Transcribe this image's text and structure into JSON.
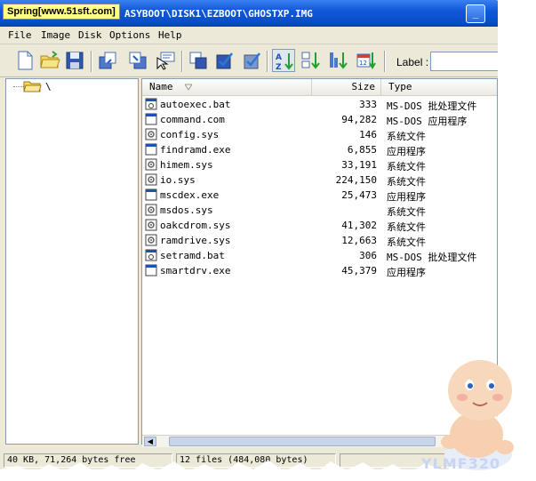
{
  "window": {
    "watermark": "Spring[www.51sft.com]",
    "title_path": "ASYBOOT\\DISK1\\EZBOOT\\GHOSTXP.IMG",
    "title_color": "#0a4cc8"
  },
  "menu": [
    {
      "label": "File"
    },
    {
      "label": "Image"
    },
    {
      "label": "Disk"
    },
    {
      "label": "Options"
    },
    {
      "label": "Help"
    }
  ],
  "toolbar": {
    "label_caption": "Label :",
    "label_value": "",
    "buttons": [
      {
        "icon": "new-file-icon"
      },
      {
        "icon": "open-folder-icon"
      },
      {
        "icon": "save-disk-icon"
      },
      {
        "icon": "extract-icon"
      },
      {
        "icon": "inject-icon"
      },
      {
        "icon": "select-icon"
      },
      {
        "icon": "copy-disk-icon"
      },
      {
        "icon": "check-icon"
      },
      {
        "icon": "verify-icon"
      },
      {
        "icon": "sort-name-icon"
      },
      {
        "icon": "sort-type-icon"
      },
      {
        "icon": "sort-size-icon"
      },
      {
        "icon": "sort-date-icon"
      }
    ]
  },
  "tree": {
    "root_label": "\\"
  },
  "list": {
    "columns": {
      "name": "Name",
      "size": "Size",
      "type": "Type"
    },
    "files": [
      {
        "name": "autoexec.bat",
        "size": "333",
        "type": "MS-DOS 批处理文件",
        "icon": "batch-file-icon"
      },
      {
        "name": "command.com",
        "size": "94,282",
        "type": "MS-DOS 应用程序",
        "icon": "application-icon"
      },
      {
        "name": "config.sys",
        "size": "146",
        "type": "系统文件",
        "icon": "system-file-icon"
      },
      {
        "name": "findramd.exe",
        "size": "6,855",
        "type": "应用程序",
        "icon": "application-icon"
      },
      {
        "name": "himem.sys",
        "size": "33,191",
        "type": "系统文件",
        "icon": "system-file-icon"
      },
      {
        "name": "io.sys",
        "size": "224,150",
        "type": "系统文件",
        "icon": "system-file-icon"
      },
      {
        "name": "mscdex.exe",
        "size": "25,473",
        "type": "应用程序",
        "icon": "application-icon"
      },
      {
        "name": "msdos.sys",
        "size": "",
        "type": "系统文件",
        "icon": "system-file-icon"
      },
      {
        "name": "oakcdrom.sys",
        "size": "41,302",
        "type": "系统文件",
        "icon": "system-file-icon"
      },
      {
        "name": "ramdrive.sys",
        "size": "12,663",
        "type": "系统文件",
        "icon": "system-file-icon"
      },
      {
        "name": "setramd.bat",
        "size": "306",
        "type": "MS-DOS 批处理文件",
        "icon": "batch-file-icon"
      },
      {
        "name": "smartdrv.exe",
        "size": "45,379",
        "type": "应用程序",
        "icon": "application-icon"
      }
    ]
  },
  "status": {
    "free": "40 KB, 71,264 bytes free",
    "files": "12 files (484,080 bytes)"
  },
  "mascot": {
    "brand": "YLMF320"
  }
}
